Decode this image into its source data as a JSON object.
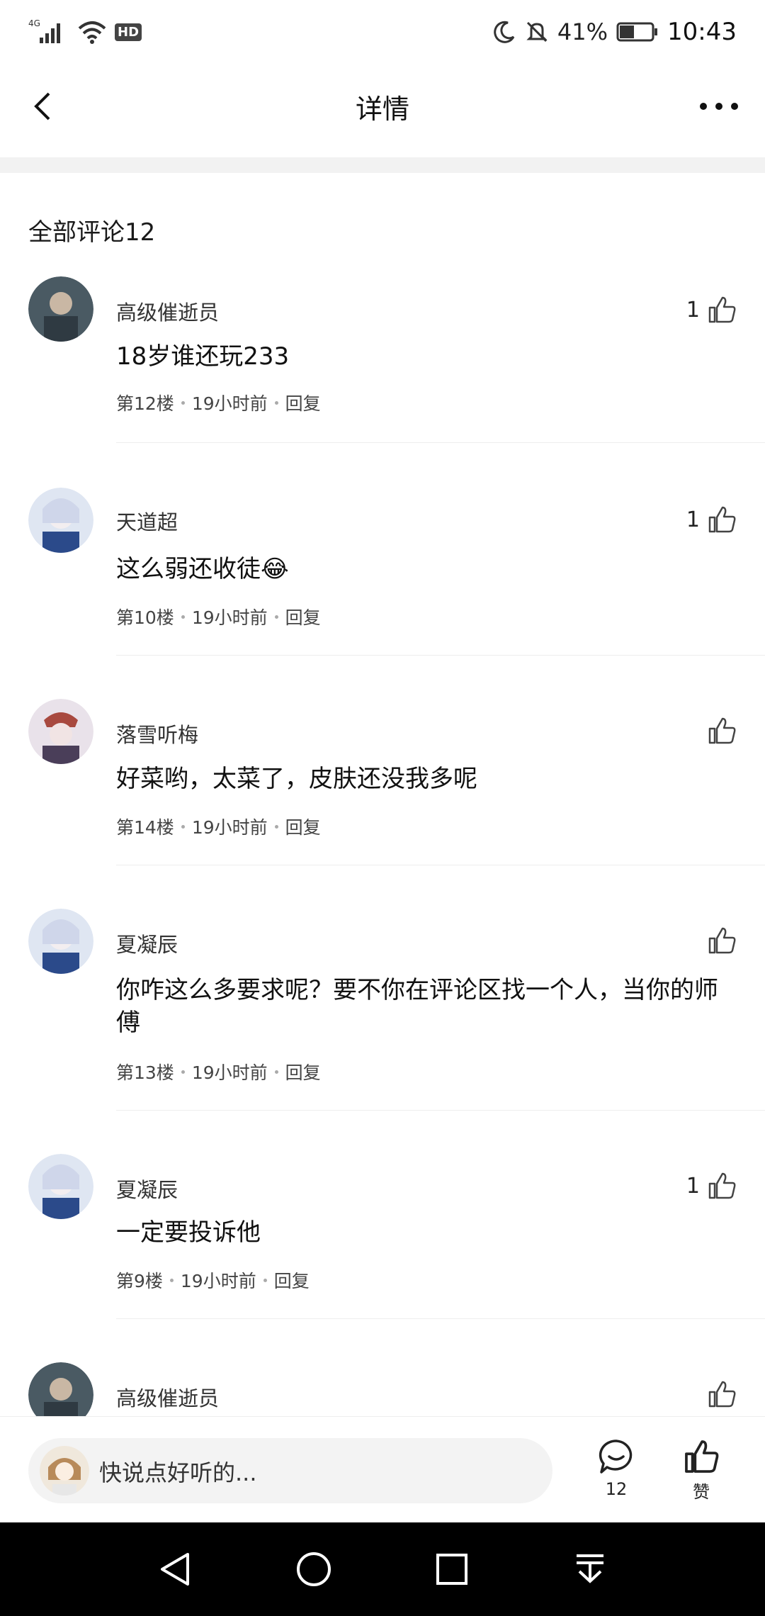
{
  "status_bar": {
    "network": "4G",
    "hd": "HD",
    "battery": "41%",
    "time": "10:43"
  },
  "header": {
    "title": "详情"
  },
  "section": {
    "title": "全部评论12"
  },
  "comments": [
    {
      "username": "高级催逝员",
      "content": "18岁谁还玩233",
      "floor": "第12楼",
      "time": "19小时前",
      "reply": "回复",
      "likes": "1"
    },
    {
      "username": "天道超",
      "content": "这么弱还收徒😂",
      "floor": "第10楼",
      "time": "19小时前",
      "reply": "回复",
      "likes": "1"
    },
    {
      "username": "落雪听梅",
      "content": "好菜哟，太菜了，皮肤还没我多呢",
      "floor": "第14楼",
      "time": "19小时前",
      "reply": "回复",
      "likes": ""
    },
    {
      "username": "夏凝辰",
      "content": "你咋这么多要求呢？要不你在评论区找一个人，当你的师傅",
      "floor": "第13楼",
      "time": "19小时前",
      "reply": "回复",
      "likes": ""
    },
    {
      "username": "夏凝辰",
      "content": "一定要投诉他",
      "floor": "第9楼",
      "time": "19小时前",
      "reply": "回复",
      "likes": "1"
    },
    {
      "username": "高级催逝员",
      "content": "",
      "floor": "",
      "time": "",
      "reply": "",
      "likes": ""
    }
  ],
  "bottom_bar": {
    "input_placeholder": "快说点好听的...",
    "comment_count": "12",
    "like_label": "赞"
  }
}
